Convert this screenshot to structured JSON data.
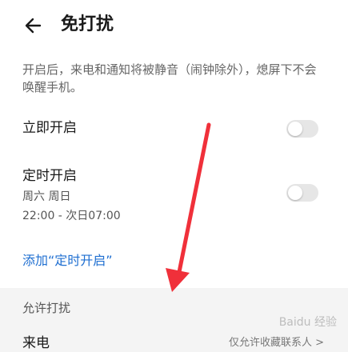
{
  "header": {
    "title": "免打扰"
  },
  "description": "开启后，来电和通知将被静音（闹钟除外），熄屏下不会唤醒手机。",
  "immediate": {
    "label": "立即开启"
  },
  "scheduled": {
    "label": "定时开启",
    "days": "周六 周日",
    "time": "22:00 - 次日07:00"
  },
  "add_link": "添加“定时开启”",
  "allow_section": {
    "title": "允许打扰"
  },
  "calls": {
    "label": "来电",
    "value": "仅允许收藏联系人 >"
  },
  "watermark": "Baidu 经验",
  "colors": {
    "accent": "#1f6fd1",
    "arrow": "#f0303a"
  }
}
